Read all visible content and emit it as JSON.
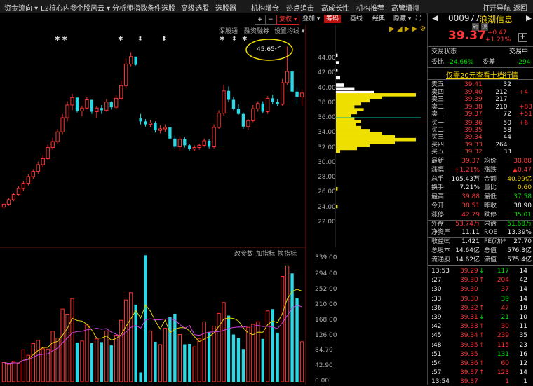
{
  "topbar": {
    "items": [
      "资金流向 ▾",
      "L2核心内参",
      "个股风云 ▾",
      "分析师指数",
      "条件选股",
      "高级选股",
      "选股器",
      "机构增仓",
      "热点追击",
      "高成长性",
      "机构推荐",
      "高管增持",
      "打开导航",
      "返回"
    ]
  },
  "toolbar": {
    "buttons": [
      "+",
      "−",
      "复权 ▾",
      "筹码",
      "画线",
      "经典",
      "隐藏 ▾"
    ]
  },
  "chart_bar": {
    "links": [
      "深股通",
      "融资融券",
      "设置均线 ▾"
    ],
    "max_label": "45.65",
    "star_marks": [
      "✱ ✱",
      "✱",
      "⬍",
      "⬍",
      "✱",
      "⬍",
      "✱"
    ]
  },
  "vol_bar": {
    "links": [
      "改参数",
      "加指标",
      "换指标"
    ]
  },
  "price_axis": [
    "44.00",
    "42.00",
    "40.00",
    "38.00",
    "36.00",
    "34.00",
    "32.00",
    "30.00",
    "28.00",
    "26.00",
    "24.00",
    "22.00"
  ],
  "vol_axis": [
    "339.00",
    "294.00",
    "252.00",
    "210.00",
    "168.00",
    "126.00",
    "84.70",
    "42.90",
    "0.00"
  ],
  "stock": {
    "code": "000977",
    "name": "浪潮信息",
    "price": "39.37",
    "change": "+0.47",
    "pct": "+1.21%",
    "badges": [
      "融",
      "通"
    ]
  },
  "status": {
    "label": "交易状态",
    "value": "交易中"
  },
  "ratio": {
    "weibi_label": "委比",
    "weibi": "-24.66%",
    "weicha_label": "委差",
    "weicha": "-294"
  },
  "promo": "仅需20元查看十档行情",
  "asks": [
    {
      "label": "卖五",
      "price": "39.41",
      "vol": "32",
      "chg": ""
    },
    {
      "label": "卖四",
      "price": "39.40",
      "vol": "212",
      "chg": "+4"
    },
    {
      "label": "卖三",
      "price": "39.39",
      "vol": "217",
      "chg": ""
    },
    {
      "label": "卖二",
      "price": "39.38",
      "vol": "210",
      "chg": "+83"
    },
    {
      "label": "卖一",
      "price": "39.37",
      "vol": "72",
      "chg": "+51"
    }
  ],
  "bids": [
    {
      "label": "买一",
      "price": "39.36",
      "vol": "50",
      "chg": "+6"
    },
    {
      "label": "买二",
      "price": "39.35",
      "vol": "58",
      "chg": ""
    },
    {
      "label": "买三",
      "price": "39.34",
      "vol": "44",
      "chg": ""
    },
    {
      "label": "买四",
      "price": "39.33",
      "vol": "264",
      "chg": ""
    },
    {
      "label": "买五",
      "price": "39.32",
      "vol": "33",
      "chg": ""
    }
  ],
  "stats": [
    {
      "l1": "最新",
      "v1": "39.37",
      "c1": "red",
      "l2": "均价",
      "v2": "38.88",
      "c2": "red"
    },
    {
      "l1": "涨幅",
      "v1": "+1.21%",
      "c1": "red",
      "l2": "涨跌",
      "v2": "▲0.47",
      "c2": "red"
    },
    {
      "l1": "总手",
      "v1": "105.43万",
      "c1": "white",
      "l2": "金额",
      "v2": "40.99亿",
      "c2": "yellow"
    },
    {
      "l1": "换手",
      "v1": "7.21%",
      "c1": "white",
      "l2": "量比",
      "v2": "0.60",
      "c2": "yellow"
    },
    {
      "l1": "最高",
      "v1": "39.88",
      "c1": "red",
      "l2": "最低",
      "v2": "37.58",
      "c2": "green"
    },
    {
      "l1": "今开",
      "v1": "38.51",
      "c1": "red",
      "l2": "昨收",
      "v2": "38.90",
      "c2": "white"
    },
    {
      "l1": "涨停",
      "v1": "42.79",
      "c1": "red",
      "l2": "跌停",
      "v2": "35.01",
      "c2": "green"
    },
    {
      "l1": "外盘",
      "v1": "53.74万",
      "c1": "red",
      "l2": "内盘",
      "v2": "51.68万",
      "c2": "green"
    },
    {
      "l1": "净资产",
      "v1": "11.11",
      "c1": "white",
      "l2": "ROE",
      "v2": "13.39%",
      "c2": "white"
    },
    {
      "l1": "收益㈢",
      "v1": "1.421",
      "c1": "white",
      "l2": "PE(动)*",
      "v2": "27.70",
      "c2": "white"
    },
    {
      "l1": "总股本",
      "v1": "14.64亿",
      "c1": "white",
      "l2": "总值",
      "v2": "576.3亿",
      "c2": "white"
    },
    {
      "l1": "流通股",
      "v1": "14.62亿",
      "c1": "white",
      "l2": "流值",
      "v2": "575.4亿",
      "c2": "white"
    }
  ],
  "ticks": [
    {
      "t": "13:53",
      "p": "39.29",
      "a": "↓",
      "v": "117",
      "n": "14",
      "vc": "green"
    },
    {
      "t": ":27",
      "p": "39.30",
      "a": "↑",
      "v": "204",
      "n": "42",
      "vc": "red"
    },
    {
      "t": ":30",
      "p": "39.30",
      "a": "",
      "v": "37",
      "n": "14",
      "vc": "red"
    },
    {
      "t": ":33",
      "p": "39.30",
      "a": "",
      "v": "39",
      "n": "14",
      "vc": "green"
    },
    {
      "t": ":36",
      "p": "39.32",
      "a": "↑",
      "v": "47",
      "n": "19",
      "vc": "red"
    },
    {
      "t": ":39",
      "p": "39.31",
      "a": "↓",
      "v": "21",
      "n": "10",
      "vc": "green"
    },
    {
      "t": ":42",
      "p": "39.33",
      "a": "↑",
      "v": "30",
      "n": "11",
      "vc": "red"
    },
    {
      "t": ":45",
      "p": "39.34",
      "a": "↑",
      "v": "239",
      "n": "35",
      "vc": "red"
    },
    {
      "t": ":48",
      "p": "39.35",
      "a": "↑",
      "v": "115",
      "n": "23",
      "vc": "red"
    },
    {
      "t": ":51",
      "p": "39.35",
      "a": "",
      "v": "131",
      "n": "16",
      "vc": "green"
    },
    {
      "t": ":54",
      "p": "39.36",
      "a": "↑",
      "v": "60",
      "n": "12",
      "vc": "red"
    },
    {
      "t": ":57",
      "p": "39.37",
      "a": "↑",
      "v": "123",
      "n": "14",
      "vc": "red"
    },
    {
      "t": "13:54",
      "p": "39.37",
      "a": "",
      "v": "1",
      "n": "1",
      "vc": "red"
    }
  ],
  "chart_data": {
    "type": "candlestick",
    "price_axis": {
      "min": 21,
      "max": 46,
      "ticks": [
        22,
        24,
        26,
        28,
        30,
        32,
        34,
        36,
        38,
        40,
        42,
        44
      ]
    },
    "volume_axis": {
      "min": 0,
      "max": 339,
      "ticks": [
        0,
        42.9,
        84.7,
        126,
        168,
        210,
        252,
        294,
        339
      ]
    },
    "annotated_high": 45.65,
    "candles": [
      [
        24.1,
        24.6,
        23.9,
        24.5
      ],
      [
        24.5,
        25.3,
        24.3,
        25.1
      ],
      [
        25.1,
        26.0,
        24.9,
        25.8
      ],
      [
        25.8,
        26.9,
        25.6,
        26.6
      ],
      [
        26.6,
        27.6,
        26.3,
        27.3
      ],
      [
        27.3,
        28.5,
        27.0,
        28.2
      ],
      [
        28.2,
        29.2,
        27.9,
        28.9
      ],
      [
        28.9,
        30.2,
        28.6,
        29.8
      ],
      [
        29.8,
        31.1,
        29.4,
        30.6
      ],
      [
        30.6,
        32.5,
        30.4,
        32.1
      ],
      [
        32.1,
        33.4,
        31.8,
        32.9
      ],
      [
        32.9,
        34.6,
        32.6,
        34.2
      ],
      [
        34.2,
        36.6,
        33.9,
        36.1
      ],
      [
        36.1,
        38.3,
        35.6,
        37.8
      ],
      [
        37.8,
        39.3,
        37.1,
        38.8
      ],
      [
        38.8,
        38.4,
        36.8,
        37.0
      ],
      [
        37.0,
        37.7,
        36.3,
        37.4
      ],
      [
        37.4,
        38.9,
        37.2,
        38.5
      ],
      [
        38.5,
        38.2,
        36.6,
        36.9
      ],
      [
        36.9,
        37.6,
        36.1,
        37.4
      ],
      [
        37.4,
        37.8,
        36.6,
        37.1
      ],
      [
        37.1,
        38.6,
        36.9,
        38.2
      ],
      [
        38.2,
        38.3,
        37.2,
        37.5
      ],
      [
        37.5,
        39.1,
        37.3,
        38.7
      ],
      [
        38.7,
        41.1,
        38.4,
        40.4
      ],
      [
        40.4,
        44.1,
        40.1,
        43.3
      ],
      [
        43.3,
        44.9,
        43.0,
        44.3
      ],
      [
        44.3,
        44.0,
        43.1,
        43.2
      ],
      [
        36.0,
        36.6,
        35.2,
        35.6
      ],
      [
        35.6,
        35.9,
        34.9,
        35.2
      ],
      [
        35.2,
        35.8,
        34.8,
        35.4
      ],
      [
        35.4,
        35.6,
        34.1,
        34.4
      ],
      [
        34.4,
        35.1,
        34.0,
        34.6
      ],
      [
        34.6,
        35.2,
        34.2,
        34.8
      ],
      [
        34.8,
        34.9,
        33.1,
        33.3
      ],
      [
        33.3,
        33.7,
        31.9,
        32.2
      ],
      [
        32.2,
        33.6,
        31.7,
        33.2
      ],
      [
        33.2,
        33.5,
        32.1,
        32.4
      ],
      [
        32.4,
        32.6,
        31.7,
        31.9
      ],
      [
        31.9,
        32.4,
        31.6,
        32.1
      ],
      [
        32.1,
        32.6,
        31.8,
        32.4
      ],
      [
        32.4,
        33.3,
        32.2,
        33.0
      ],
      [
        33.0,
        33.2,
        32.0,
        32.2
      ],
      [
        32.2,
        35.2,
        32.0,
        34.8
      ],
      [
        34.8,
        37.1,
        34.6,
        36.7
      ],
      [
        36.7,
        40.5,
        36.4,
        39.7
      ],
      [
        39.7,
        40.3,
        38.2,
        38.5
      ],
      [
        38.5,
        38.9,
        37.1,
        37.3
      ],
      [
        37.3,
        37.9,
        36.5,
        36.6
      ],
      [
        36.6,
        36.8,
        34.6,
        34.9
      ],
      [
        34.9,
        35.9,
        34.5,
        35.7
      ],
      [
        35.7,
        37.8,
        35.5,
        37.3
      ],
      [
        37.3,
        38.3,
        36.9,
        38.0
      ],
      [
        38.0,
        38.3,
        36.7,
        36.9
      ],
      [
        36.9,
        39.0,
        36.6,
        38.7
      ],
      [
        38.7,
        39.2,
        37.9,
        38.2
      ],
      [
        38.2,
        38.6,
        37.6,
        37.9
      ],
      [
        37.9,
        41.3,
        37.7,
        40.8
      ],
      [
        40.8,
        45.65,
        40.5,
        42.3
      ],
      [
        42.3,
        42.5,
        39.4,
        39.6
      ],
      [
        39.6,
        40.2,
        38.0,
        38.9
      ],
      [
        38.9,
        39.9,
        37.6,
        39.4
      ]
    ],
    "volumes": [
      53,
      48,
      56,
      50,
      88,
      73,
      105,
      114,
      91,
      90,
      139,
      120,
      200,
      186,
      229,
      108,
      112,
      156,
      106,
      118,
      109,
      140,
      100,
      128,
      169,
      225,
      245,
      212,
      26,
      348,
      140,
      110,
      102,
      147,
      178,
      187,
      130,
      103,
      104,
      96,
      119,
      165,
      137,
      153,
      188,
      218,
      182,
      130,
      120,
      90,
      150,
      158,
      165,
      118,
      195,
      200,
      135,
      290,
      319,
      298,
      230,
      110
    ]
  }
}
